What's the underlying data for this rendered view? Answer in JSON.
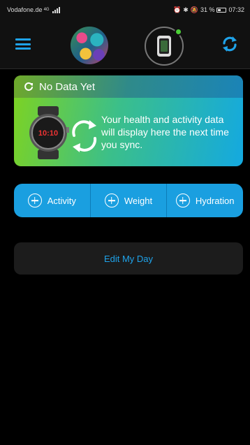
{
  "status_bar": {
    "carrier": "Vodafone.de",
    "network": "4G",
    "battery": "31 %",
    "time": "07:32"
  },
  "header": {
    "menu_icon": "hamburger-menu-icon",
    "avatar": "profile-avatar",
    "device_icon": "watch-device-icon",
    "device_status_color": "#4cd137",
    "sync_icon": "sync-icon"
  },
  "nodata_card": {
    "title": "No Data Yet",
    "message": "Your health and activity data will display here the next time you sync.",
    "watch_time": "10:10"
  },
  "quick_add": [
    {
      "label": "Activity"
    },
    {
      "label": "Weight"
    },
    {
      "label": "Hydration"
    }
  ],
  "edit_day": {
    "label": "Edit My Day"
  },
  "colors": {
    "accent": "#1fa3ea",
    "quick_add_bg": "#1a9fe0",
    "background": "#000000"
  }
}
